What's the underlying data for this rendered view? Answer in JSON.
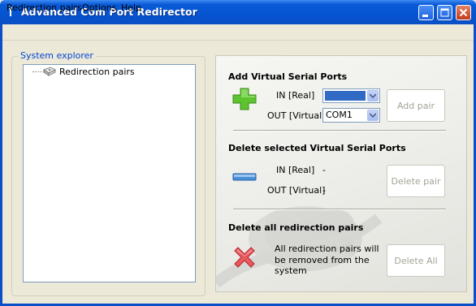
{
  "window": {
    "title": "Advanced Com Port Redirector",
    "icon": "app-icon"
  },
  "menu": {
    "items": [
      "Redirection pairs",
      "Options",
      "Help"
    ]
  },
  "explorer": {
    "legend": "System explorer",
    "node": "Redirection pairs"
  },
  "add_section": {
    "heading": "Add Virtual Serial Ports",
    "in_label": "IN [Real]",
    "in_value": "",
    "out_label": "OUT [Virtual]",
    "out_value": "COM1",
    "button": "Add pair"
  },
  "delete_section": {
    "heading": "Delete selected Virtual Serial Ports",
    "in_label": "IN [Real]",
    "in_value": "-",
    "out_label": "OUT [Virtual]",
    "out_value": "-",
    "button": "Delete pair"
  },
  "delete_all_section": {
    "heading": "Delete all redirection pairs",
    "message_lines": [
      "All redirection pairs will",
      "be removed from the",
      "system"
    ],
    "button": "Delete All"
  },
  "colors": {
    "title_bar": "#0454d2",
    "selection": "#316ac5",
    "add_icon": "#5dc32f",
    "remove_icon": "#4a8fd8",
    "delete_all_icon": "#e8585c"
  }
}
